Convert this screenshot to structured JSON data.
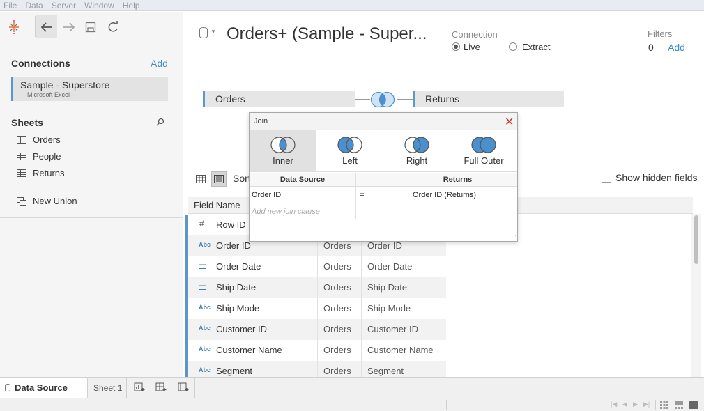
{
  "menu": [
    "File",
    "Data",
    "Server",
    "Window",
    "Help"
  ],
  "connections": {
    "title": "Connections",
    "add_label": "Add",
    "item_name": "Sample - Superstore",
    "item_type": "Microsoft Excel"
  },
  "sheets": {
    "title": "Sheets",
    "items": [
      "Orders",
      "People",
      "Returns"
    ],
    "new_union": "New Union"
  },
  "datasource": {
    "title": "Orders+ (Sample - Super...",
    "connection_label": "Connection",
    "live_label": "Live",
    "extract_label": "Extract",
    "connection_mode": "Live",
    "filters_label": "Filters",
    "filters_count": "0",
    "filters_add": "Add"
  },
  "join_tables": {
    "left": "Orders",
    "right": "Returns"
  },
  "join_dialog": {
    "title": "Join",
    "types": [
      "Inner",
      "Left",
      "Right",
      "Full Outer"
    ],
    "selected": "Inner",
    "col_left": "Data Source",
    "col_right": "Returns",
    "clause_left": "Order ID",
    "clause_op": "=",
    "clause_right": "Order ID (Returns)",
    "placeholder": "Add new join clause"
  },
  "grid_toolbar": {
    "sort_label": "Sort",
    "show_hidden_label": "Show hidden fields",
    "show_hidden_checked": false
  },
  "field_grid": {
    "header": "Field Name",
    "rows": [
      {
        "type": "#",
        "name": "Row ID",
        "table": "",
        "remote": ""
      },
      {
        "type": "Abc",
        "name": "Order ID",
        "table": "Orders",
        "remote": "Order ID"
      },
      {
        "type": "date",
        "name": "Order Date",
        "table": "Orders",
        "remote": "Order Date"
      },
      {
        "type": "date",
        "name": "Ship Date",
        "table": "Orders",
        "remote": "Ship Date"
      },
      {
        "type": "Abc",
        "name": "Ship Mode",
        "table": "Orders",
        "remote": "Ship Mode"
      },
      {
        "type": "Abc",
        "name": "Customer ID",
        "table": "Orders",
        "remote": "Customer ID"
      },
      {
        "type": "Abc",
        "name": "Customer Name",
        "table": "Orders",
        "remote": "Customer Name"
      },
      {
        "type": "Abc",
        "name": "Segment",
        "table": "Orders",
        "remote": "Segment"
      }
    ]
  },
  "bottom_tabs": {
    "data_source": "Data Source",
    "sheet": "Sheet 1"
  },
  "colors": {
    "accent": "#3f8dc6",
    "table_bar": "#5b97c7",
    "venn_fill": "#4a90cf"
  }
}
